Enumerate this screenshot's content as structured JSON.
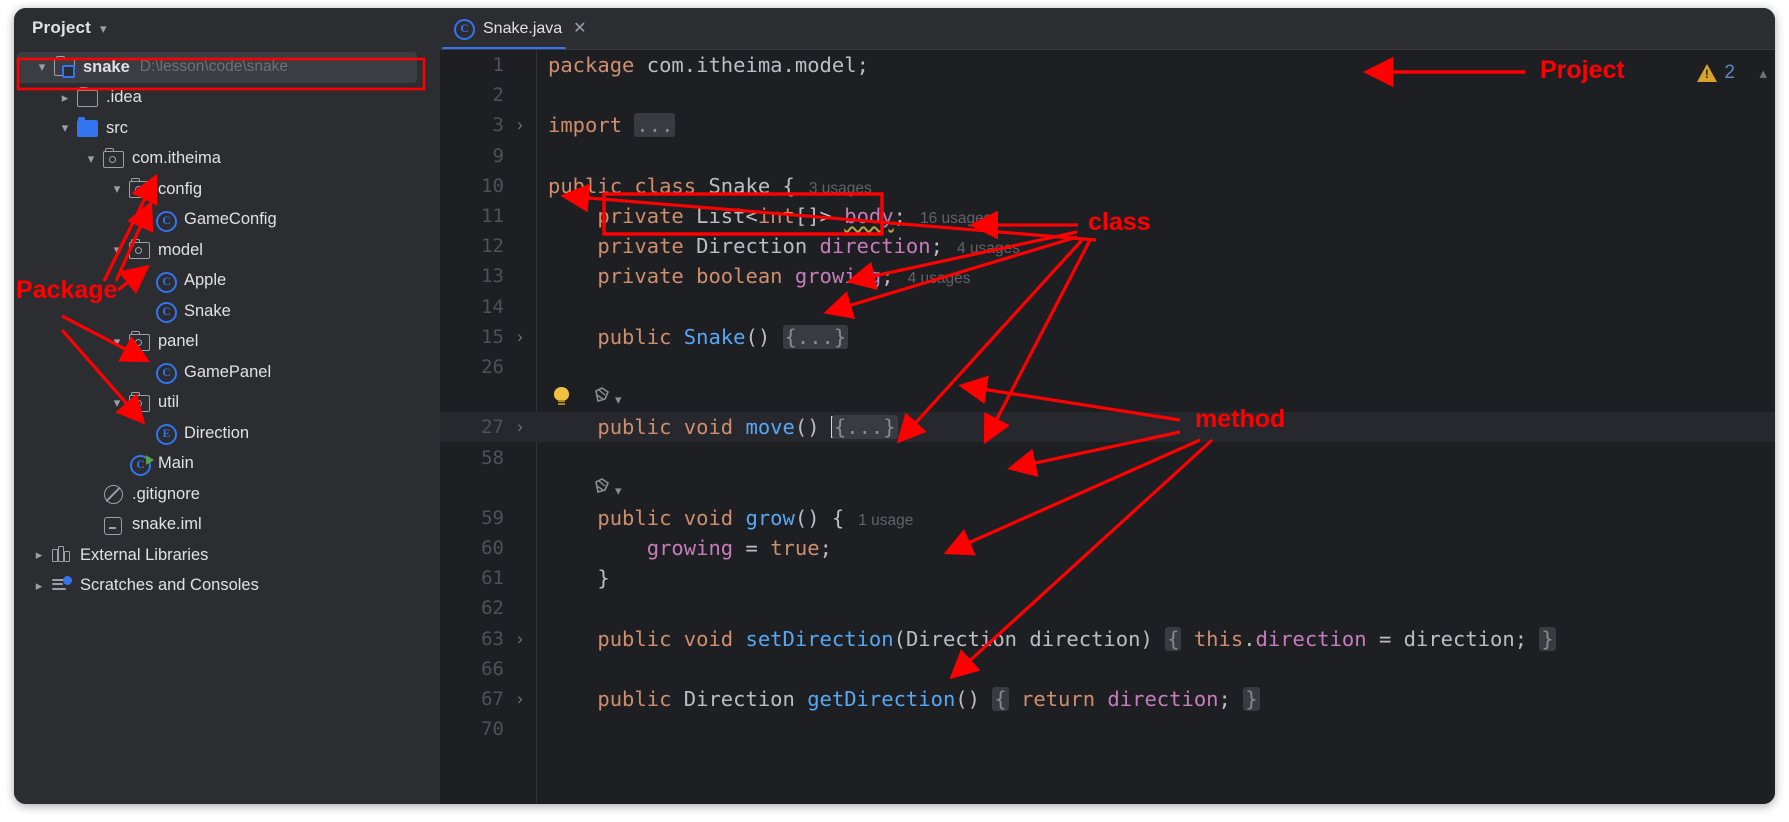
{
  "window": {
    "background": "#ffffff",
    "ide_bg": "#2b2d30",
    "editor_bg": "#1e1f22",
    "accent": "#3574f0",
    "annotation_color": "#ff0000"
  },
  "project_panel": {
    "title": "Project",
    "collapse_icon": "chevron-down-icon",
    "tree": [
      {
        "label": "snake",
        "path": "D:\\lesson\\code\\snake",
        "icon": "project-root-icon",
        "twisty": "chevron-down-icon",
        "indent": 0,
        "selected": true,
        "bold": true
      },
      {
        "label": ".idea",
        "path": "",
        "icon": "folder-plain-icon",
        "twisty": "chevron-right-icon",
        "indent": 1,
        "selected": false,
        "bold": false
      },
      {
        "label": "src",
        "path": "",
        "icon": "folder-source-icon",
        "twisty": "chevron-down-icon",
        "indent": 1,
        "selected": false,
        "bold": false
      },
      {
        "label": "com.itheima",
        "path": "",
        "icon": "folder-package-icon",
        "twisty": "chevron-down-icon",
        "indent": 2,
        "selected": false,
        "bold": false
      },
      {
        "label": "config",
        "path": "",
        "icon": "folder-package-icon",
        "twisty": "chevron-down-icon",
        "indent": 3,
        "selected": false,
        "bold": false
      },
      {
        "label": "GameConfig",
        "path": "",
        "icon": "java-class-icon",
        "twisty": "none",
        "indent": 4,
        "selected": false,
        "bold": false
      },
      {
        "label": "model",
        "path": "",
        "icon": "folder-package-icon",
        "twisty": "chevron-down-icon",
        "indent": 3,
        "selected": false,
        "bold": false
      },
      {
        "label": "Apple",
        "path": "",
        "icon": "java-class-icon",
        "twisty": "none",
        "indent": 4,
        "selected": false,
        "bold": false
      },
      {
        "label": "Snake",
        "path": "",
        "icon": "java-class-icon",
        "twisty": "none",
        "indent": 4,
        "selected": false,
        "bold": false
      },
      {
        "label": "panel",
        "path": "",
        "icon": "folder-package-icon",
        "twisty": "chevron-down-icon",
        "indent": 3,
        "selected": false,
        "bold": false
      },
      {
        "label": "GamePanel",
        "path": "",
        "icon": "java-class-icon",
        "twisty": "none",
        "indent": 4,
        "selected": false,
        "bold": false
      },
      {
        "label": "util",
        "path": "",
        "icon": "folder-package-icon",
        "twisty": "chevron-down-icon",
        "indent": 3,
        "selected": false,
        "bold": false
      },
      {
        "label": "Direction",
        "path": "",
        "icon": "java-enum-icon",
        "twisty": "none",
        "indent": 4,
        "selected": false,
        "bold": false
      },
      {
        "label": "Main",
        "path": "",
        "icon": "java-main-class-icon",
        "twisty": "none",
        "indent": 3,
        "selected": false,
        "bold": false
      },
      {
        "label": ".gitignore",
        "path": "",
        "icon": "gitignore-icon",
        "twisty": "none",
        "indent": 2,
        "selected": false,
        "bold": false
      },
      {
        "label": "snake.iml",
        "path": "",
        "icon": "iml-file-icon",
        "twisty": "none",
        "indent": 2,
        "selected": false,
        "bold": false
      },
      {
        "label": "External Libraries",
        "path": "",
        "icon": "libraries-icon",
        "twisty": "chevron-right-icon",
        "indent": 0,
        "selected": false,
        "bold": false
      },
      {
        "label": "Scratches and Consoles",
        "path": "",
        "icon": "scratches-icon",
        "twisty": "chevron-right-icon",
        "indent": 0,
        "selected": false,
        "bold": false
      }
    ]
  },
  "editor": {
    "tab": {
      "label": "Snake.java",
      "icon": "java-class-icon",
      "close_icon": "close-icon",
      "active": true
    },
    "warning": {
      "icon": "warning-triangle-icon",
      "count": "2",
      "chevron": "chevron-up-icon"
    },
    "lines": [
      {
        "num": "1",
        "fold": "none",
        "highlight": false,
        "tokens": [
          {
            "t": "package ",
            "c": "kw"
          },
          {
            "t": "com.itheima.model;",
            "c": "typ"
          }
        ],
        "usage": ""
      },
      {
        "num": "2",
        "fold": "none",
        "highlight": false,
        "tokens": [],
        "usage": ""
      },
      {
        "num": "3",
        "fold": "chevron-right-icon",
        "highlight": false,
        "tokens": [
          {
            "t": "import ",
            "c": "kw"
          },
          {
            "t": "...",
            "c": "fold-badge"
          }
        ],
        "usage": ""
      },
      {
        "num": "9",
        "fold": "none",
        "highlight": false,
        "tokens": [],
        "usage": ""
      },
      {
        "num": "10",
        "fold": "none",
        "highlight": false,
        "tokens": [
          {
            "t": "public class ",
            "c": "kw"
          },
          {
            "t": "Snake",
            "c": "typ"
          },
          {
            "t": " {",
            "c": "pun"
          }
        ],
        "usage": "3 usages"
      },
      {
        "num": "11",
        "fold": "none",
        "highlight": false,
        "tokens": [
          {
            "t": "    private ",
            "c": "kw"
          },
          {
            "t": "List",
            "c": "typ"
          },
          {
            "t": "<",
            "c": "pun"
          },
          {
            "t": "int",
            "c": "kw"
          },
          {
            "t": "[]> ",
            "c": "pun"
          },
          {
            "t": "body",
            "c": "fld squiggle"
          },
          {
            "t": ";",
            "c": "pun"
          }
        ],
        "usage": "16 usages"
      },
      {
        "num": "12",
        "fold": "none",
        "highlight": false,
        "tokens": [
          {
            "t": "    private ",
            "c": "kw"
          },
          {
            "t": "Direction ",
            "c": "typ"
          },
          {
            "t": "direction",
            "c": "fld"
          },
          {
            "t": ";",
            "c": "pun"
          }
        ],
        "usage": "4 usages"
      },
      {
        "num": "13",
        "fold": "none",
        "highlight": false,
        "tokens": [
          {
            "t": "    private ",
            "c": "kw"
          },
          {
            "t": "boolean ",
            "c": "kw"
          },
          {
            "t": "growing",
            "c": "fld"
          },
          {
            "t": ";",
            "c": "pun"
          }
        ],
        "usage": "4 usages"
      },
      {
        "num": "14",
        "fold": "none",
        "highlight": false,
        "tokens": [],
        "usage": ""
      },
      {
        "num": "15",
        "fold": "chevron-right-icon",
        "highlight": false,
        "tokens": [
          {
            "t": "    public ",
            "c": "kw"
          },
          {
            "t": "Snake",
            "c": "mth"
          },
          {
            "t": "() ",
            "c": "pun"
          },
          {
            "t": "{...}",
            "c": "fold-badge"
          }
        ],
        "usage": ""
      },
      {
        "num": "26",
        "fold": "none",
        "highlight": false,
        "tokens": [],
        "usage": ""
      },
      {
        "num": "27",
        "fold": "chevron-right-icon",
        "highlight": true,
        "tokens": [
          {
            "t": "    public void ",
            "c": "kw"
          },
          {
            "t": "move",
            "c": "mth"
          },
          {
            "t": "() ",
            "c": "pun"
          },
          {
            "t": "CARET",
            "c": "caret"
          },
          {
            "t": "{...}",
            "c": "fold-badge"
          }
        ],
        "usage": ""
      },
      {
        "num": "58",
        "fold": "none",
        "highlight": false,
        "tokens": [],
        "usage": ""
      },
      {
        "num": "59",
        "fold": "none",
        "highlight": false,
        "tokens": [
          {
            "t": "    public void ",
            "c": "kw"
          },
          {
            "t": "grow",
            "c": "mth"
          },
          {
            "t": "() {",
            "c": "pun"
          }
        ],
        "usage": "1 usage"
      },
      {
        "num": "60",
        "fold": "none",
        "highlight": false,
        "tokens": [
          {
            "t": "        ",
            "c": "pun"
          },
          {
            "t": "growing",
            "c": "fld"
          },
          {
            "t": " = ",
            "c": "pun"
          },
          {
            "t": "true",
            "c": "kw"
          },
          {
            "t": ";",
            "c": "pun"
          }
        ],
        "usage": ""
      },
      {
        "num": "61",
        "fold": "none",
        "highlight": false,
        "tokens": [
          {
            "t": "    }",
            "c": "pun"
          }
        ],
        "usage": ""
      },
      {
        "num": "62",
        "fold": "none",
        "highlight": false,
        "tokens": [],
        "usage": ""
      },
      {
        "num": "63",
        "fold": "chevron-right-icon",
        "highlight": false,
        "tokens": [
          {
            "t": "    public void ",
            "c": "kw"
          },
          {
            "t": "setDirection",
            "c": "mth"
          },
          {
            "t": "(",
            "c": "pun"
          },
          {
            "t": "Direction direction",
            "c": "typ"
          },
          {
            "t": ") ",
            "c": "pun"
          },
          {
            "t": "{",
            "c": "fold-badge"
          },
          {
            "t": " ",
            "c": "pun"
          },
          {
            "t": "this",
            "c": "kw"
          },
          {
            "t": ".",
            "c": "pun"
          },
          {
            "t": "direction",
            "c": "fld"
          },
          {
            "t": " = direction;",
            "c": "pun"
          },
          {
            "t": " ",
            "c": "pun"
          },
          {
            "t": "}",
            "c": "fold-badge"
          }
        ],
        "usage": ""
      },
      {
        "num": "66",
        "fold": "none",
        "highlight": false,
        "tokens": [],
        "usage": ""
      },
      {
        "num": "67",
        "fold": "chevron-right-icon",
        "highlight": false,
        "tokens": [
          {
            "t": "    public ",
            "c": "kw"
          },
          {
            "t": "Direction ",
            "c": "typ"
          },
          {
            "t": "getDirection",
            "c": "mth"
          },
          {
            "t": "() ",
            "c": "pun"
          },
          {
            "t": "{",
            "c": "fold-badge"
          },
          {
            "t": " ",
            "c": "pun"
          },
          {
            "t": "return",
            "c": "kw"
          },
          {
            "t": " ",
            "c": "pun"
          },
          {
            "t": "direction",
            "c": "fld"
          },
          {
            "t": ";",
            "c": "pun"
          },
          {
            "t": " ",
            "c": "pun"
          },
          {
            "t": "}",
            "c": "fold-badge"
          }
        ],
        "usage": ""
      },
      {
        "num": "70",
        "fold": "none",
        "highlight": false,
        "tokens": [],
        "usage": ""
      }
    ],
    "gutter_decorations": {
      "bulb_icon": "lightbulb-icon",
      "override_icon": "implementing-method-icon",
      "override_chevron": "chevron-down-icon"
    }
  },
  "annotations": {
    "project_label": "Project",
    "package_label": "Package",
    "class_label": "class",
    "method_label": "method"
  }
}
